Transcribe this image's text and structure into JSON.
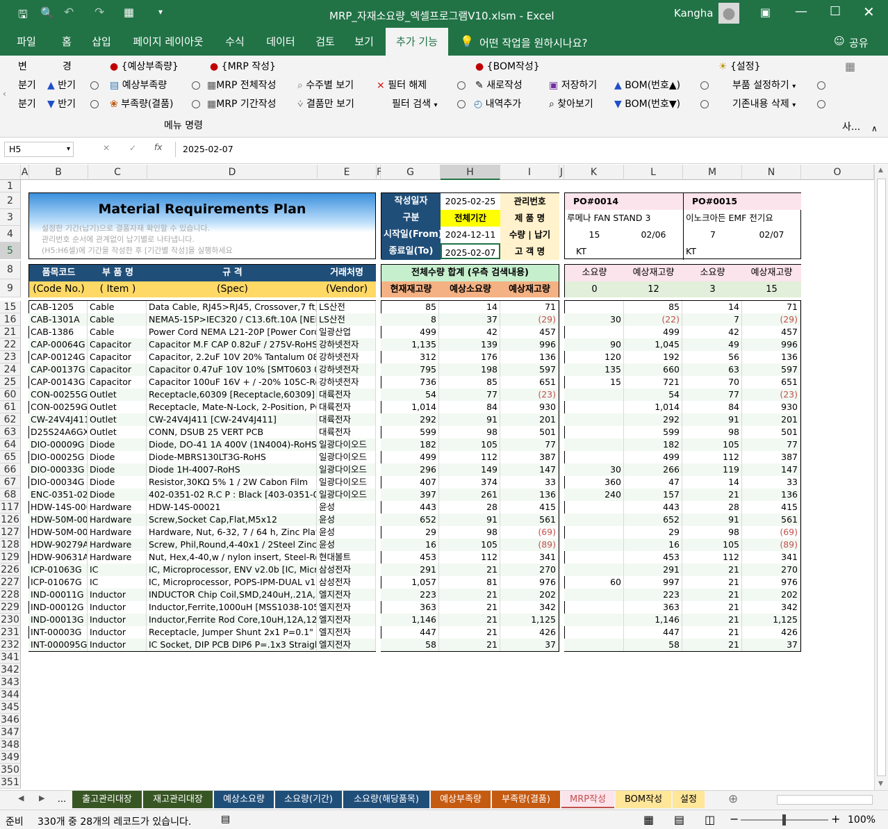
{
  "app": {
    "title": "MRP_자재소요량_엑셀프로그램V10.xlsm  -  Excel",
    "user": "Kangha"
  },
  "tabs": [
    "파일",
    "홈",
    "삽입",
    "페이지 레이아웃",
    "수식",
    "데이터",
    "검토",
    "보기",
    "추가 기능"
  ],
  "tellme": "어떤 작업을 원하시나요?",
  "share": "공유",
  "ribbon": {
    "g1": [
      "변",
      "경",
      "분기",
      "반기",
      "분기",
      "반기"
    ],
    "g2_head": "{예상부족량}",
    "g2": [
      "예상부족량",
      "부족량(결품)"
    ],
    "g3_head": "{MRP 작성}",
    "g3": [
      "MRP 전체작성",
      "MRP 기간작성",
      "수주별 보기",
      "결품만 보기",
      "필터 해제",
      "필터 검색"
    ],
    "g4_head": "{BOM작성}",
    "g4": [
      "새로작성",
      "내역추가",
      "저장하기",
      "찾아보기",
      "BOM(번호▲)",
      "BOM(번호▼)"
    ],
    "g5_head": "{설정}",
    "g5": [
      "부품 설정하기",
      "기존내용 삭제"
    ],
    "group_label": "메뉴 명령",
    "side_label": "사..."
  },
  "formula": {
    "namebox": "H5",
    "value": "2025-02-07"
  },
  "cols": [
    "A",
    "B",
    "C",
    "D",
    "E",
    "F",
    "G",
    "H",
    "I",
    "J",
    "K",
    "L",
    "M",
    "N",
    "O"
  ],
  "header": {
    "title": "Material Requirements Plan",
    "desc1": "설정한 기간(납기)으로 결품자재 확인할 수 있습니다.",
    "desc2": "관리번호 순서에 관계없이 납기별로 나타냅니다.",
    "desc3": "(H5:H6셀)에 기간을 작성한 후 [기간별 작성]을 실행하세요",
    "date_label": "작성일자",
    "date": "2025-02-25",
    "mgmt": "관리번호",
    "kind_label": "구분",
    "kind": "전체기간",
    "product": "제 품 명",
    "start_label": "시작일(From)",
    "start": "2024-12-11",
    "qty_due": "수량 | 납기",
    "end_label": "종료일(To)",
    "end": "2025-02-07",
    "customer": "고 객 명",
    "po1": "PO#0014",
    "po2": "PO#0015",
    "prod1": "루메나 FAN STAND 3",
    "prod2": "이노크아든 EMF 전기요",
    "qty1": "15",
    "due1": "02/06",
    "qty2": "7",
    "due2": "02/07",
    "cust1": "KT",
    "cust2": "KT",
    "h_code": "품목코드",
    "h_name": "부 품 명",
    "h_spec": "규    격",
    "h_vendor": "거래처명",
    "h_code2": "(Code No.)",
    "h_name2": "( Item )",
    "h_spec2": "(Spec)",
    "h_vendor2": "(Vendor)",
    "h_total": "전체수량 합계 (우측 검색내용)",
    "h_stock": "현재재고량",
    "h_need": "예상소요량",
    "h_exp": "예상재고량",
    "h_req1": "소요량",
    "h_exp1": "예상재고량",
    "h_req2": "소요량",
    "h_exp2": "예상재고량",
    "sum_req1": "0",
    "sum_exp1": "12",
    "sum_req2": "3",
    "sum_exp2": "15"
  },
  "rows": [
    {
      "r": "15",
      "code": "CAB-1205",
      "item": "Cable",
      "spec": "Data Cable, RJ45>RJ45, Crossover,7 ft, F",
      "vendor": "LS산전",
      "g": "85",
      "h": "14",
      "i": "71",
      "k": "",
      "l": "85",
      "m": "14",
      "n": "71"
    },
    {
      "r": "16",
      "code": "CAB-1301A",
      "item": "Cable",
      "spec": "NEMA5-15P>IEC320 / C13.6ft.10A [NEMA",
      "vendor": "LS산전",
      "g": "8",
      "h": "37",
      "i": "(29)",
      "k": "30",
      "l": "(22)",
      "m": "7",
      "n": "(29)"
    },
    {
      "r": "21",
      "code": "CAB-1386",
      "item": "Cable",
      "spec": "Power Cord NEMA L21-20P [Power Cord",
      "vendor": "일광산업",
      "g": "499",
      "h": "42",
      "i": "457",
      "k": "",
      "l": "499",
      "m": "42",
      "n": "457"
    },
    {
      "r": "22",
      "code": "CAP-00064G",
      "item": "Capacitor",
      "spec": "Capacitor M.F CAP 0.82uF / 275V-RoHS",
      "vendor": "강하넷전자",
      "g": "1,135",
      "h": "139",
      "i": "996",
      "k": "90",
      "l": "1,045",
      "m": "49",
      "n": "996"
    },
    {
      "r": "23",
      "code": "CAP-00124G",
      "item": "Capacitor",
      "spec": "Capacitor, 2.2uF 10V 20% Tantalum 0805",
      "vendor": "강하넷전자",
      "g": "312",
      "h": "176",
      "i": "136",
      "k": "120",
      "l": "192",
      "m": "56",
      "n": "136"
    },
    {
      "r": "24",
      "code": "CAP-00137G",
      "item": "Capacitor",
      "spec": "Capacitor 0.47uF 10V 10% [SMT0603 06",
      "vendor": "강하넷전자",
      "g": "795",
      "h": "198",
      "i": "597",
      "k": "135",
      "l": "660",
      "m": "63",
      "n": "597"
    },
    {
      "r": "25",
      "code": "CAP-00143G",
      "item": "Capacitor",
      "spec": "Capacitor 100uF 16V + / -20% 105C-RoH",
      "vendor": "강하넷전자",
      "g": "736",
      "h": "85",
      "i": "651",
      "k": "15",
      "l": "721",
      "m": "70",
      "n": "651"
    },
    {
      "r": "60",
      "code": "CON-00255G",
      "item": "Outlet",
      "spec": "Receptacle,60309 [Receptacle,60309]",
      "vendor": "대륙전자",
      "g": "54",
      "h": "77",
      "i": "(23)",
      "k": "",
      "l": "54",
      "m": "77",
      "n": "(23)"
    },
    {
      "r": "61",
      "code": "CON-00259G",
      "item": "Outlet",
      "spec": "Receptacle, Mate-N-Lock, 2-Position, PCB",
      "vendor": "대륙전자",
      "g": "1,014",
      "h": "84",
      "i": "930",
      "k": "",
      "l": "1,014",
      "m": "84",
      "n": "930"
    },
    {
      "r": "62",
      "code": "CW-24V4J411",
      "item": "Outlet",
      "spec": "CW-24V4J411 [CW-24V4J411]",
      "vendor": "대륙전자",
      "g": "292",
      "h": "91",
      "i": "201",
      "k": "",
      "l": "292",
      "m": "91",
      "n": "201"
    },
    {
      "r": "63",
      "code": "D25S24A6GX0",
      "item": "Outlet",
      "spec": "CONN, DSUB 25 VERT PCB",
      "vendor": "대륙전자",
      "g": "599",
      "h": "98",
      "i": "501",
      "k": "",
      "l": "599",
      "m": "98",
      "n": "501"
    },
    {
      "r": "64",
      "code": "DIO-00009G",
      "item": "Diode",
      "spec": "Diode, DO-41 1A 400V (1N4004)-RoHS",
      "vendor": "일광다이오드",
      "g": "182",
      "h": "105",
      "i": "77",
      "k": "",
      "l": "182",
      "m": "105",
      "n": "77"
    },
    {
      "r": "65",
      "code": "DIO-00025G",
      "item": "Diode",
      "spec": "Diode-MBRS130LT3G-RoHS",
      "vendor": "일광다이오드",
      "g": "499",
      "h": "112",
      "i": "387",
      "k": "",
      "l": "499",
      "m": "112",
      "n": "387"
    },
    {
      "r": "66",
      "code": "DIO-00033G",
      "item": "Diode",
      "spec": "Diode 1H-4007-RoHS",
      "vendor": "일광다이오드",
      "g": "296",
      "h": "149",
      "i": "147",
      "k": "30",
      "l": "266",
      "m": "119",
      "n": "147"
    },
    {
      "r": "67",
      "code": "DIO-00034G",
      "item": "Diode",
      "spec": "Resistor,30KΩ 5% 1 / 2W Cabon Film",
      "vendor": "일광다이오드",
      "g": "407",
      "h": "374",
      "i": "33",
      "k": "360",
      "l": "47",
      "m": "14",
      "n": "33"
    },
    {
      "r": "68",
      "code": "ENC-0351-02-",
      "item": "Diode",
      "spec": "402-0351-02 R.C P : Black [403-0351-02",
      "vendor": "일광다이오드",
      "g": "397",
      "h": "261",
      "i": "136",
      "k": "240",
      "l": "157",
      "m": "21",
      "n": "136"
    },
    {
      "r": "117",
      "code": "HDW-14S-000",
      "item": "Hardware",
      "spec": "HDW-14S-00021",
      "vendor": "윤성",
      "g": "443",
      "h": "28",
      "i": "415",
      "k": "",
      "l": "443",
      "m": "28",
      "n": "415"
    },
    {
      "r": "126",
      "code": "HDW-50M-00",
      "item": "Hardware",
      "spec": "Screw,Socket Cap,Flat,M5x12",
      "vendor": "윤성",
      "g": "652",
      "h": "91",
      "i": "561",
      "k": "",
      "l": "652",
      "m": "91",
      "n": "561"
    },
    {
      "r": "127",
      "code": "HDW-50M-00",
      "item": "Hardware",
      "spec": "Hardware, Nut, 6-32, 7 / 64 h, Zinc Plate",
      "vendor": "윤성",
      "g": "29",
      "h": "98",
      "i": "(69)",
      "k": "",
      "l": "29",
      "m": "98",
      "n": "(69)"
    },
    {
      "r": "128",
      "code": "HDW-90279A",
      "item": "Hardware",
      "spec": "Screw, Phil,Round,4-40x1 / 2Steel Zinc-R",
      "vendor": "윤성",
      "g": "16",
      "h": "105",
      "i": "(89)",
      "k": "",
      "l": "16",
      "m": "105",
      "n": "(89)"
    },
    {
      "r": "129",
      "code": "HDW-90631A",
      "item": "Hardware",
      "spec": "Nut, Hex,4-40,w / nylon insert, Steel-RoH",
      "vendor": "현대볼트",
      "g": "453",
      "h": "112",
      "i": "341",
      "k": "",
      "l": "453",
      "m": "112",
      "n": "341"
    },
    {
      "r": "226",
      "code": "ICP-01063G",
      "item": "IC",
      "spec": "IC, Microprocessor, ENV v2.0b [IC, Micro",
      "vendor": "삼성전자",
      "g": "291",
      "h": "21",
      "i": "270",
      "k": "",
      "l": "291",
      "m": "21",
      "n": "270"
    },
    {
      "r": "227",
      "code": "ICP-01067G",
      "item": "IC",
      "spec": "IC, Microprocessor, POPS-IPM-DUAL v1.0",
      "vendor": "삼성전자",
      "g": "1,057",
      "h": "81",
      "i": "976",
      "k": "60",
      "l": "997",
      "m": "21",
      "n": "976"
    },
    {
      "r": "228",
      "code": "IND-00011G",
      "item": "Inductor",
      "spec": "INDUCTOR Chip Coil,SMD,240uH,.21A,32",
      "vendor": "엘지전자",
      "g": "223",
      "h": "21",
      "i": "202",
      "k": "",
      "l": "223",
      "m": "21",
      "n": "202"
    },
    {
      "r": "229",
      "code": "IND-00012G",
      "item": "Inductor",
      "spec": "Inductor,Ferrite,1000uH [MSS1038-105LC",
      "vendor": "엘지전자",
      "g": "363",
      "h": "21",
      "i": "342",
      "k": "",
      "l": "363",
      "m": "21",
      "n": "342"
    },
    {
      "r": "230",
      "code": "IND-00013G",
      "item": "Inductor",
      "spec": "Inductor,Ferrite Rod Core,10uH,12A,12m",
      "vendor": "엘지전자",
      "g": "1,146",
      "h": "21",
      "i": "1,125",
      "k": "",
      "l": "1,146",
      "m": "21",
      "n": "1,125"
    },
    {
      "r": "231",
      "code": "INT-00003G",
      "item": "Inductor",
      "spec": "Receptacle, Jumper Shunt 2x1 P=0.1\" St",
      "vendor": "엘지전자",
      "g": "447",
      "h": "21",
      "i": "426",
      "k": "",
      "l": "447",
      "m": "21",
      "n": "426"
    },
    {
      "r": "232",
      "code": "INT-000095G",
      "item": "Inductor",
      "spec": "IC Socket, DIP PCB DIP6 P=.1x3 Straight",
      "vendor": "엘지전자",
      "g": "58",
      "h": "21",
      "i": "37",
      "k": "",
      "l": "58",
      "m": "21",
      "n": "37"
    }
  ],
  "empty_rows": [
    "341",
    "342",
    "343",
    "344",
    "345",
    "346",
    "347",
    "348",
    "349",
    "350",
    "351"
  ],
  "top_rows": [
    "1",
    "2",
    "3",
    "4",
    "5",
    "8",
    "9"
  ],
  "sheets": [
    {
      "label": "...",
      "color": "#f3f3f3",
      "fg": "#000"
    },
    {
      "label": "출고관리대장",
      "color": "#375623",
      "fg": "#fff"
    },
    {
      "label": "재고관리대장",
      "color": "#375623",
      "fg": "#fff"
    },
    {
      "label": "예상소요량",
      "color": "#1f4e79",
      "fg": "#fff"
    },
    {
      "label": "소요량(기간)",
      "color": "#1f4e79",
      "fg": "#fff"
    },
    {
      "label": "소요량(해당품목)",
      "color": "#1f4e79",
      "fg": "#fff"
    },
    {
      "label": "예상부족량",
      "color": "#c55a11",
      "fg": "#fff"
    },
    {
      "label": "부족량(결품)",
      "color": "#c55a11",
      "fg": "#fff"
    },
    {
      "label": "MRP작성",
      "color": "#fce4ec",
      "fg": "#c0504d"
    },
    {
      "label": "BOM작성",
      "color": "#ffe699",
      "fg": "#000"
    },
    {
      "label": "설정",
      "color": "#ffe699",
      "fg": "#000"
    }
  ],
  "status": {
    "ready": "준비",
    "records": "330개 중 28개의 레코드가 있습니다.",
    "zoom": "100%"
  }
}
